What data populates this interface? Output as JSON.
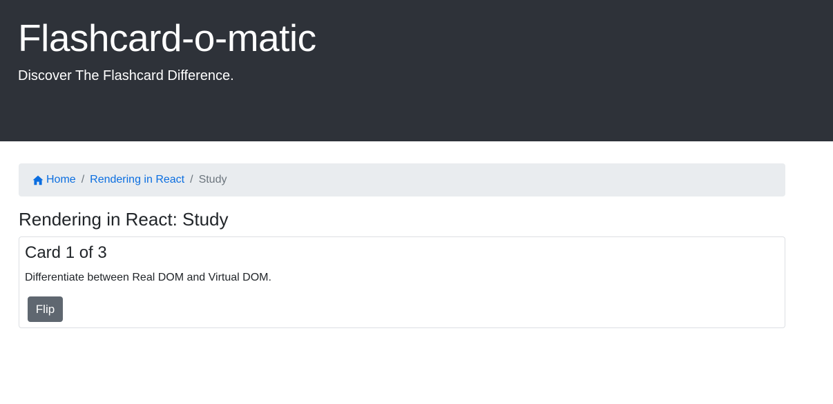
{
  "header": {
    "title": "Flashcard-o-matic",
    "subtitle": "Discover The Flashcard Difference."
  },
  "breadcrumb": {
    "home_label": "Home",
    "deck_label": "Rendering in React",
    "separator": "/",
    "current_label": "Study"
  },
  "page": {
    "heading": "Rendering in React: Study"
  },
  "card": {
    "title": "Card 1 of 3",
    "front_text": "Differentiate between Real DOM and Virtual DOM.",
    "flip_label": "Flip"
  },
  "icons": {
    "home": "home-icon"
  },
  "colors": {
    "header_bg": "#2e3239",
    "link": "#0b6ee0",
    "breadcrumb_bg": "#e9ecef",
    "button_bg": "#5f6770"
  }
}
